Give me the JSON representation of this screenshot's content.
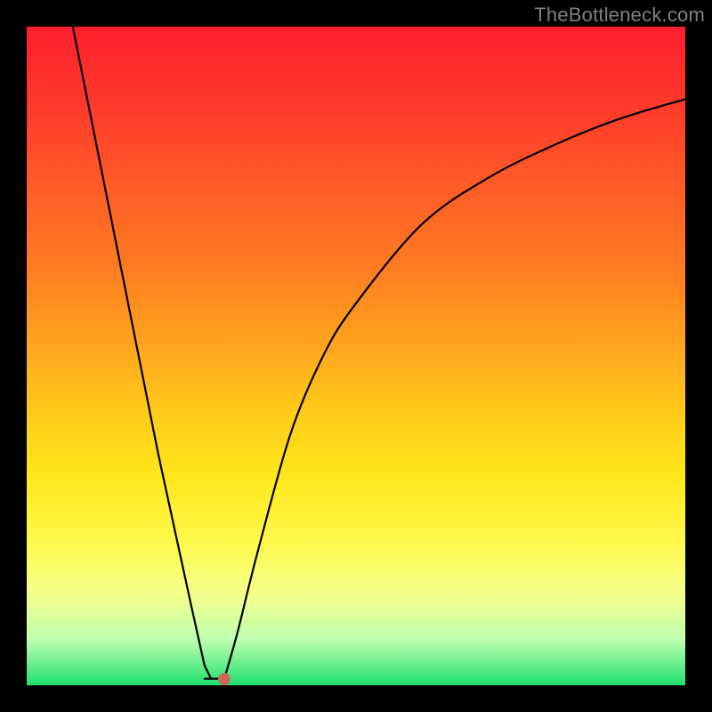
{
  "watermark": "TheBottleneck.com",
  "chart_data": {
    "type": "line",
    "title": "",
    "xlabel": "",
    "ylabel": "",
    "xlim": [
      0,
      100
    ],
    "ylim": [
      0,
      100
    ],
    "left_branch": {
      "x": [
        7,
        10,
        15,
        20,
        25,
        27,
        28
      ],
      "y": [
        100,
        85,
        60,
        35,
        12,
        3,
        1
      ]
    },
    "right_branch": {
      "x": [
        30,
        32,
        35,
        40,
        45,
        50,
        60,
        70,
        80,
        90,
        100
      ],
      "y": [
        1,
        8,
        20,
        38,
        50,
        58,
        70,
        77,
        82,
        86,
        89
      ]
    },
    "floor": {
      "x": [
        27,
        30
      ],
      "y": [
        1,
        1
      ]
    },
    "marker": {
      "x": 30,
      "y": 1
    },
    "gradient_colors": {
      "top": "#ff1f2e",
      "bottom": "#20e070"
    },
    "marker_color": "#c96a5a"
  }
}
